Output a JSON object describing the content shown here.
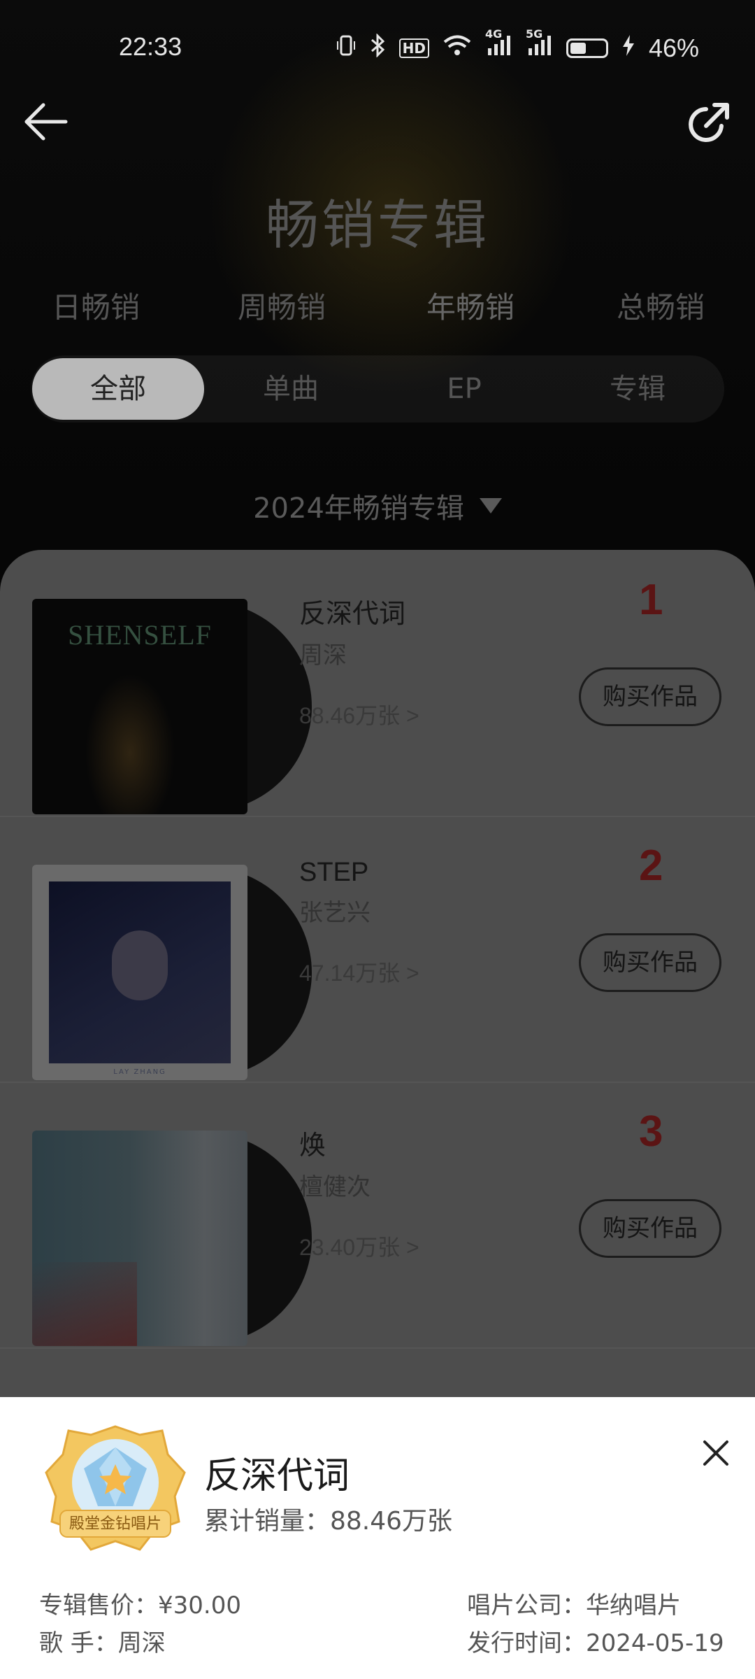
{
  "status_bar": {
    "time": "22:33",
    "network_hd": "HD",
    "net1": "4G",
    "net2": "5G",
    "battery_pct": "46%",
    "battery_level": 0.46
  },
  "header": {
    "title": "畅销专辑"
  },
  "period_tabs": [
    "日畅销",
    "周畅销",
    "年畅销",
    "总畅销"
  ],
  "type_filters": [
    "全部",
    "单曲",
    "EP",
    "专辑"
  ],
  "year_selector": "2024年畅销专辑",
  "albums": [
    {
      "rank": "1",
      "title": "反深代词",
      "artist": "周深",
      "sales": "88.46万张 >",
      "buy_label": "购买作品",
      "cover_text": "SHENSELF"
    },
    {
      "rank": "2",
      "title": "STEP",
      "artist": "张艺兴",
      "sales": "47.14万张 >",
      "buy_label": "购买作品",
      "cover_text": "LAY ZHANG"
    },
    {
      "rank": "3",
      "title": "焕",
      "artist": "檀健次",
      "sales": "23.40万张 >",
      "buy_label": "购买作品"
    }
  ],
  "detail": {
    "badge_text": "殿堂金钻唱片",
    "title": "反深代词",
    "total_sales": "累计销量：88.46万张",
    "price": "专辑售价：¥30.00",
    "company": "唱片公司：华纳唱片",
    "singer": "歌 手：周深",
    "release_date": "发行时间：2024-05-19"
  }
}
